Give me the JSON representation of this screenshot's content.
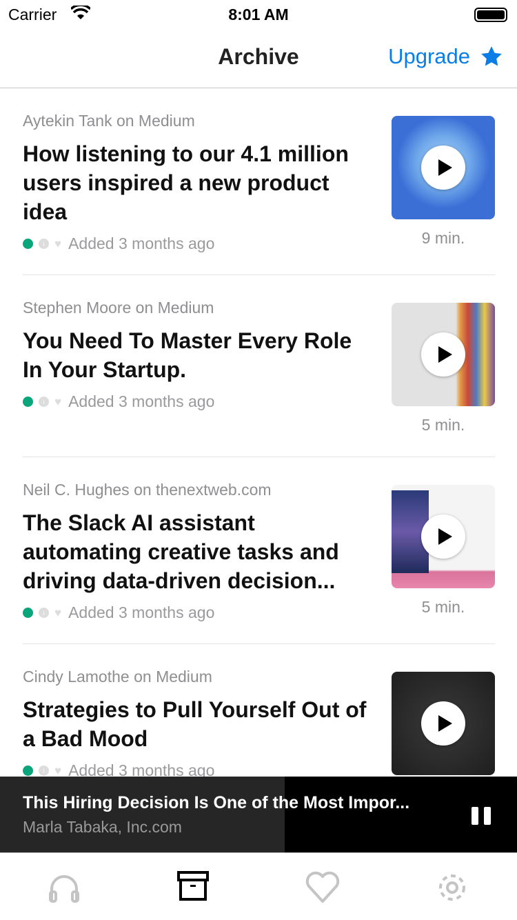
{
  "status_bar": {
    "carrier": "Carrier",
    "time": "8:01 AM"
  },
  "nav": {
    "title": "Archive",
    "upgrade_label": "Upgrade"
  },
  "colors": {
    "accent": "#0a7ee6",
    "status_dot": "#0aa57a"
  },
  "articles": [
    {
      "author": "Aytekin Tank on Medium",
      "title": "How listening to our 4.1 million users inspired a new product idea",
      "added": "Added 3 months ago",
      "duration": "9 min."
    },
    {
      "author": "Stephen Moore on Medium",
      "title": "You Need To Master Every Role In Your Startup.",
      "added": "Added 3 months ago",
      "duration": "5 min."
    },
    {
      "author": "Neil C. Hughes on thenextweb.com",
      "title": "The Slack AI assistant automating creative tasks and driving data-driven decision...",
      "added": "Added 3 months ago",
      "duration": "5 min."
    },
    {
      "author": "Cindy Lamothe on Medium",
      "title": "Strategies to Pull Yourself Out of a Bad Mood",
      "added": "Added 3 months ago",
      "duration": ""
    }
  ],
  "player": {
    "title": "This Hiring Decision Is One of the Most Impor...",
    "subtitle": "Marla Tabaka, Inc.com",
    "progress_percent": 55
  },
  "tabs": [
    {
      "name": "listen",
      "active": false
    },
    {
      "name": "archive",
      "active": true
    },
    {
      "name": "favorites",
      "active": false
    },
    {
      "name": "settings",
      "active": false
    }
  ]
}
